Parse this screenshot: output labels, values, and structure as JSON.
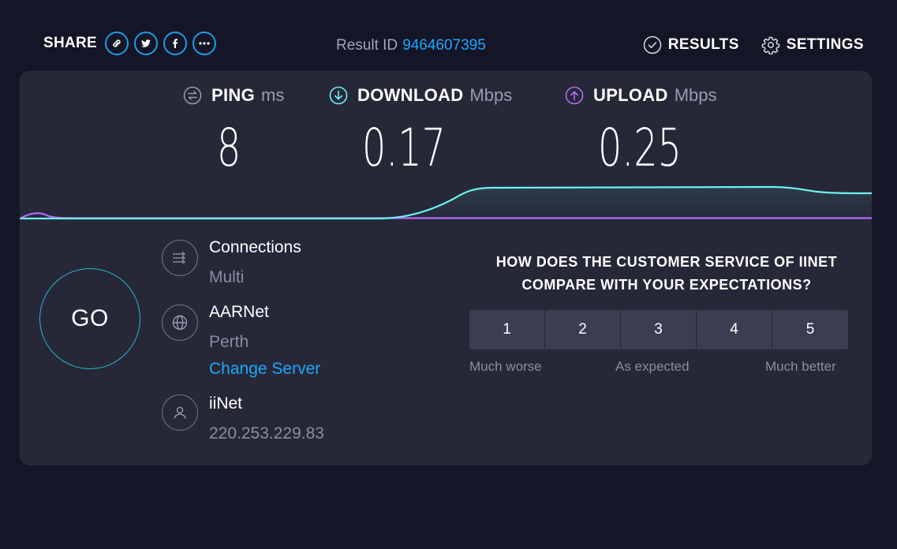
{
  "topbar": {
    "share_label": "SHARE",
    "share_icons": [
      "link-icon",
      "twitter-icon",
      "facebook-icon",
      "more-icon"
    ],
    "result_id_label": "Result ID",
    "result_id": "9464607395",
    "results_label": "RESULTS",
    "settings_label": "SETTINGS"
  },
  "metrics": {
    "ping": {
      "label": "PING",
      "unit": "ms",
      "value": "8"
    },
    "download": {
      "label": "DOWNLOAD",
      "unit": "Mbps",
      "value": "0.17"
    },
    "upload": {
      "label": "UPLOAD",
      "unit": "Mbps",
      "value": "0.25"
    }
  },
  "go_label": "GO",
  "connections": {
    "title": "Connections",
    "value": "Multi"
  },
  "server": {
    "name": "AARNet",
    "location": "Perth",
    "change_label": "Change Server"
  },
  "provider": {
    "name": "iiNet",
    "ip": "220.253.229.83"
  },
  "survey": {
    "question": "HOW DOES THE CUSTOMER SERVICE OF IINET COMPARE WITH YOUR EXPECTATIONS?",
    "options": [
      "1",
      "2",
      "3",
      "4",
      "5"
    ],
    "label_low": "Much worse",
    "label_mid": "As expected",
    "label_high": "Much better"
  },
  "colors": {
    "background": "#141526",
    "panel": "#262838",
    "accent_blue": "#1ca7ff",
    "download": "#6ef0f0",
    "upload": "#b46cf5"
  }
}
